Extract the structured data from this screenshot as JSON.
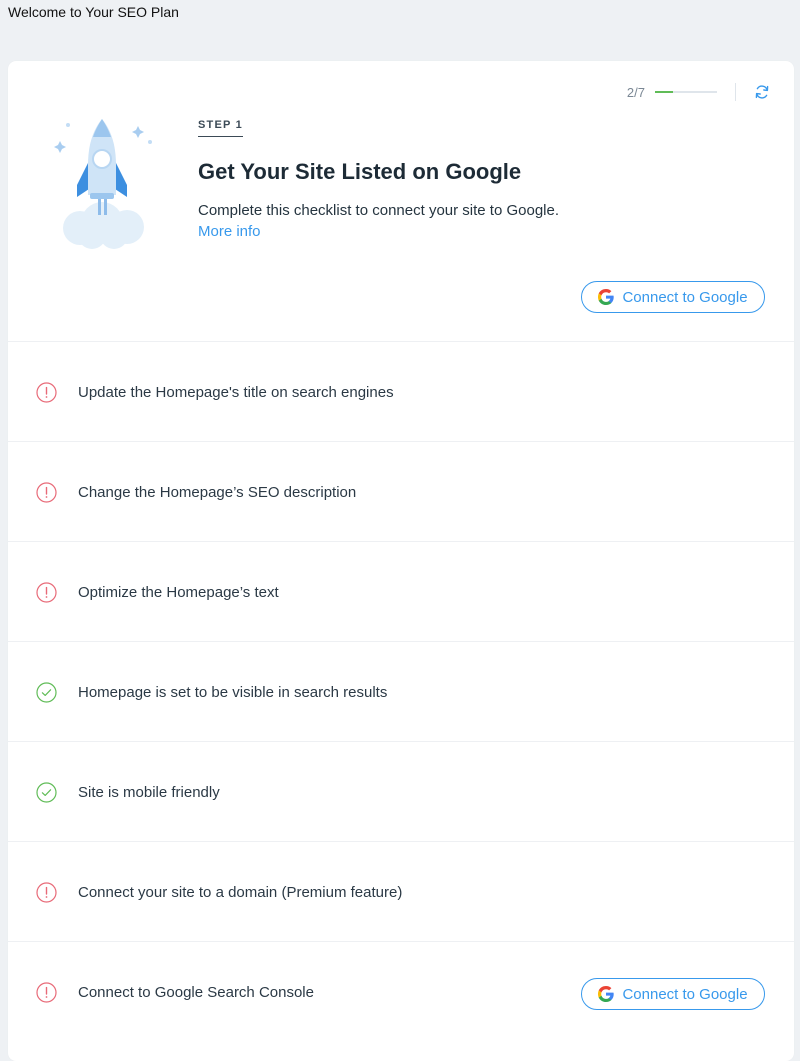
{
  "page": {
    "title": "Welcome to Your SEO Plan"
  },
  "colors": {
    "accent": "#3899ec",
    "warning": "#e86a78",
    "success": "#60bc57",
    "background": "#eef1f4"
  },
  "progress": {
    "text": "2/7",
    "fraction": 0.2857
  },
  "step": {
    "label": "STEP 1",
    "title": "Get Your Site Listed on Google",
    "description": "Complete this checklist to connect your site to Google.",
    "more_info": "More info",
    "button_label": "Connect to Google"
  },
  "checklist": [
    {
      "text": "Update the Homepage's title on search engines",
      "status": "warning",
      "icon": "warning-icon"
    },
    {
      "text": "Change the Homepage’s SEO description",
      "status": "warning",
      "icon": "warning-icon"
    },
    {
      "text": "Optimize the Homepage’s text",
      "status": "warning",
      "icon": "warning-icon"
    },
    {
      "text": "Homepage is set to be visible in search results",
      "status": "done",
      "icon": "check-icon"
    },
    {
      "text": "Site is mobile friendly",
      "status": "done",
      "icon": "check-icon"
    },
    {
      "text": "Connect your site to a domain (Premium feature)",
      "status": "warning",
      "icon": "warning-icon"
    },
    {
      "text": "Connect to Google Search Console",
      "status": "warning",
      "icon": "warning-icon",
      "button_label": "Connect to Google"
    }
  ]
}
